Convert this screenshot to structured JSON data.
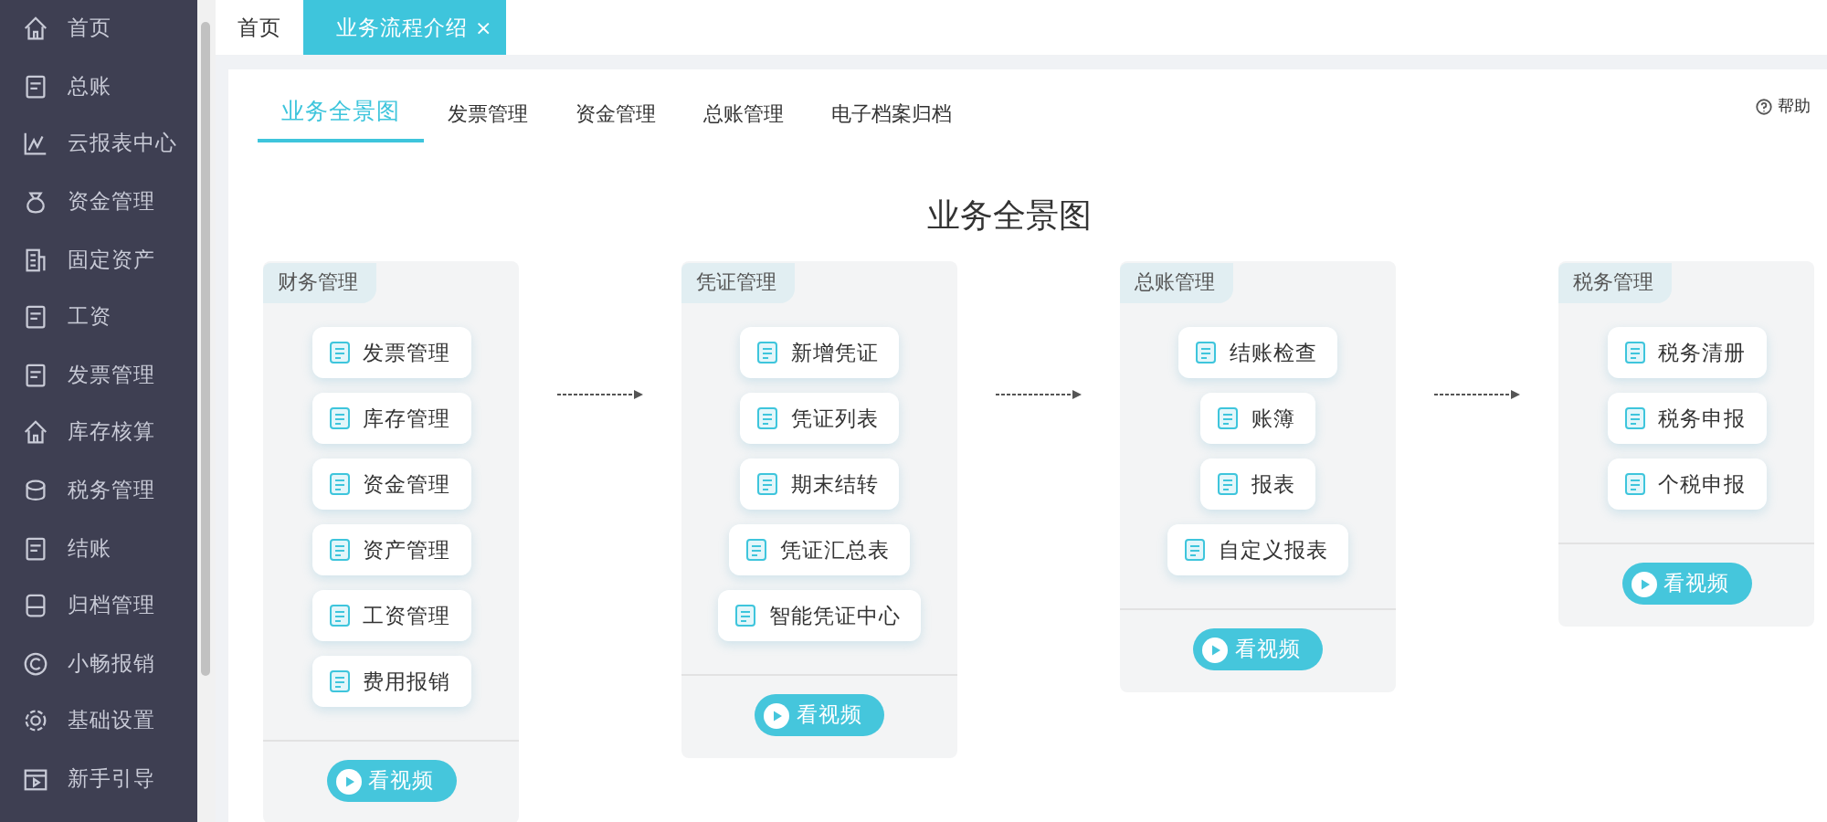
{
  "sidebar": {
    "items": [
      {
        "label": "首页"
      },
      {
        "label": "总账"
      },
      {
        "label": "云报表中心"
      },
      {
        "label": "资金管理"
      },
      {
        "label": "固定资产"
      },
      {
        "label": "工资"
      },
      {
        "label": "发票管理"
      },
      {
        "label": "库存核算"
      },
      {
        "label": "税务管理"
      },
      {
        "label": "结账"
      },
      {
        "label": "归档管理"
      },
      {
        "label": "小畅报销"
      },
      {
        "label": "基础设置"
      },
      {
        "label": "新手引导"
      }
    ]
  },
  "page_tabs": [
    {
      "label": "首页",
      "selected": false
    },
    {
      "label": "业务流程介绍",
      "selected": true,
      "close": "×"
    }
  ],
  "sub_tabs": [
    {
      "label": "业务全景图",
      "selected": true
    },
    {
      "label": "发票管理",
      "selected": false
    },
    {
      "label": "资金管理",
      "selected": false
    },
    {
      "label": "总账管理",
      "selected": false
    },
    {
      "label": "电子档案归档",
      "selected": false
    }
  ],
  "help": "帮助",
  "title": "业务全景图",
  "flow": [
    {
      "heading": "财务管理",
      "items": [
        "发票管理",
        "库存管理",
        "资金管理",
        "资产管理",
        "工资管理",
        "费用报销"
      ],
      "video_button": "看视频"
    },
    {
      "heading": "凭证管理",
      "items": [
        "新增凭证",
        "凭证列表",
        "期末结转",
        "凭证汇总表",
        "智能凭证中心"
      ],
      "video_button": "看视频"
    },
    {
      "heading": "总账管理",
      "items": [
        "结账检查",
        "账簿",
        "报表",
        "自定义报表"
      ],
      "video_button": "看视频"
    },
    {
      "heading": "税务管理",
      "items": [
        "税务清册",
        "税务申报",
        "个税申报"
      ],
      "video_button": "看视频"
    }
  ]
}
